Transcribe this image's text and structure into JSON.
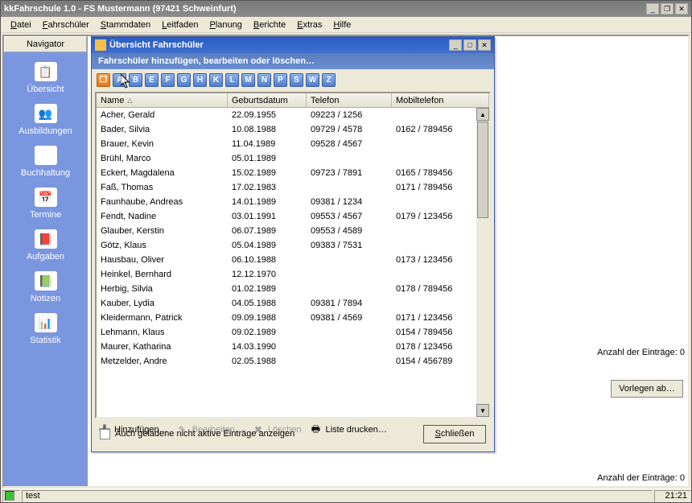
{
  "window": {
    "title": "kkFahrschule 1.0  -  FS Mustermann (97421 Schweinfurt)"
  },
  "menu": {
    "items": [
      "Datei",
      "Fahrschüler",
      "Stammdaten",
      "Leitfaden",
      "Planung",
      "Berichte",
      "Extras",
      "Hilfe"
    ]
  },
  "sidebar": {
    "title": "Navigator",
    "items": [
      {
        "label": "Übersicht",
        "icon": "📋"
      },
      {
        "label": "Ausbildungen",
        "icon": "👥"
      },
      {
        "label": "Buchhaltung",
        "icon": "🖨"
      },
      {
        "label": "Termine",
        "icon": "📅"
      },
      {
        "label": "Aufgaben",
        "icon": "📕"
      },
      {
        "label": "Notizen",
        "icon": "📗"
      },
      {
        "label": "Statistik",
        "icon": "📊"
      }
    ]
  },
  "dialog": {
    "title": "Übersicht Fahrschüler",
    "subtitle": "Fahrschüler hinzufügen, bearbeiten oder löschen…",
    "alpha": [
      "A",
      "B",
      "E",
      "F",
      "G",
      "H",
      "K",
      "L",
      "M",
      "N",
      "P",
      "S",
      "W",
      "Z"
    ],
    "cols": {
      "name": "Name",
      "dob": "Geburtsdatum",
      "tel": "Telefon",
      "mob": "Mobiltelefon"
    },
    "rows": [
      {
        "name": "Acher, Gerald",
        "dob": "22.09.1955",
        "tel": "09223 / 1256",
        "mob": ""
      },
      {
        "name": "Bader, Silvia",
        "dob": "10.08.1988",
        "tel": "09729 / 4578",
        "mob": "0162 / 789456"
      },
      {
        "name": "Brauer, Kevin",
        "dob": "11.04.1989",
        "tel": "09528 / 4567",
        "mob": ""
      },
      {
        "name": "Brühl, Marco",
        "dob": "05.01.1989",
        "tel": "",
        "mob": ""
      },
      {
        "name": "Eckert, Magdalena",
        "dob": "15.02.1989",
        "tel": "09723 / 7891",
        "mob": "0165 / 789456"
      },
      {
        "name": "Faß, Thomas",
        "dob": "17.02.1983",
        "tel": "",
        "mob": "0171 / 789456"
      },
      {
        "name": "Faunhaube, Andreas",
        "dob": "14.01.1989",
        "tel": "09381 / 1234",
        "mob": ""
      },
      {
        "name": "Fendt, Nadine",
        "dob": "03.01.1991",
        "tel": "09553 / 4567",
        "mob": "0179 / 123456"
      },
      {
        "name": "Glauber, Kerstin",
        "dob": "06.07.1989",
        "tel": "09553 / 4589",
        "mob": ""
      },
      {
        "name": "Götz, Klaus",
        "dob": "05.04.1989",
        "tel": "09383 / 7531",
        "mob": ""
      },
      {
        "name": "Hausbau, Oliver",
        "dob": "06.10.1988",
        "tel": "",
        "mob": "0173 / 123456"
      },
      {
        "name": "Heinkel, Bernhard",
        "dob": "12.12.1970",
        "tel": "",
        "mob": ""
      },
      {
        "name": "Herbig, Silvia",
        "dob": "01.02.1989",
        "tel": "",
        "mob": "0178 / 789456"
      },
      {
        "name": "Kauber, Lydia",
        "dob": "04.05.1988",
        "tel": "09381 / 7894",
        "mob": ""
      },
      {
        "name": "Kleidermann, Patrick",
        "dob": "09.09.1988",
        "tel": "09381 / 4569",
        "mob": "0171 / 123456"
      },
      {
        "name": "Lehmann, Klaus",
        "dob": "09.02.1989",
        "tel": "",
        "mob": "0154 / 789456"
      },
      {
        "name": "Maurer, Katharina",
        "dob": "14.03.1990",
        "tel": "",
        "mob": "0178 / 123456"
      },
      {
        "name": "Metzelder, Andre",
        "dob": "02.05.1988",
        "tel": "",
        "mob": "0154 / 456789"
      }
    ],
    "toolbar": {
      "add": "Hinzufügen…",
      "edit": "Bearbeiten…",
      "delete": "Löschen",
      "print": "Liste drucken…"
    },
    "checkbox": "Auch geladene nicht aktive Einträge anzeigen",
    "close": "Schließen"
  },
  "right": {
    "count_label_1": "Anzahl der Einträge: 0",
    "button": "Vorlegen ab…",
    "count_label_2": "Anzahl der Einträge: 0"
  },
  "status": {
    "text": "test",
    "time": "21:21"
  }
}
